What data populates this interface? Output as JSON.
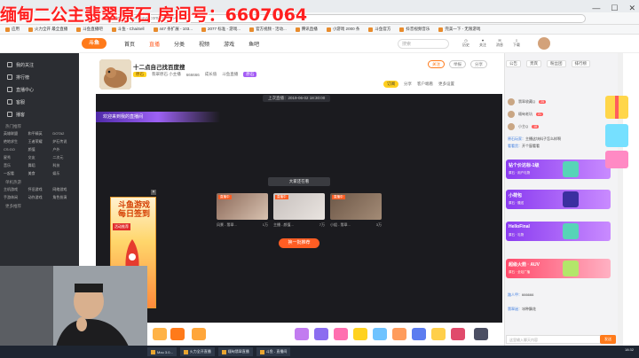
{
  "overlay_title": "缅甸二公主翡翠原石 房间号：6607064",
  "window": {
    "min": "—",
    "max": "☐",
    "close": "✕"
  },
  "address_bar": {
    "url": "https://www.douyu.com/6607064"
  },
  "bookmarks": [
    "应用",
    "火力全开 最全直播",
    "斗鱼直播吧",
    "斗鱼 - ChaiSell",
    "447 条扩展 - 103...",
    "2077 标准 - 游戏...",
    "官方视频 - 活动...",
    "腾讯直播",
    "小游戏 2000 条",
    "斗鱼官方",
    "抖音视频音乐",
    "完美一下 - 无限游戏"
  ],
  "nav": {
    "logo": "斗鱼",
    "items": [
      "首页",
      "直播",
      "分类",
      "视频",
      "游戏",
      "鱼吧"
    ],
    "active_index": 1,
    "search_placeholder": "搜索",
    "icons": [
      {
        "name": "history-icon",
        "label": "历史"
      },
      {
        "name": "follow-icon",
        "label": "关注"
      },
      {
        "name": "message-icon",
        "label": "消息"
      },
      {
        "name": "download-icon",
        "label": "下载"
      }
    ]
  },
  "sidebar": {
    "items": [
      "我的关注",
      "排行榜",
      "直播中心",
      "客服",
      "播客"
    ],
    "section_hot": "热门推荐",
    "hot_grid": [
      "英雄联盟",
      "和平精英",
      "DOTA2",
      "绝地求生",
      "王者荣耀",
      "炉石传说",
      "CS:GO",
      "颜值",
      "户外",
      "星秀",
      "交友",
      "二次元",
      "音乐",
      "舞蹈",
      "科技",
      "一起看",
      "美食",
      "娱乐"
    ],
    "section_games": "单机热游",
    "games_grid": [
      "主机游戏",
      "怀旧游戏",
      "网络游戏",
      "手游休闲",
      "动作游戏",
      "角色扮演"
    ],
    "section_more": "更多推荐"
  },
  "room": {
    "title": "十二点自己找百度搜",
    "tag": "原石",
    "category": "翡翠原石 小主播",
    "meta": [
      "666666",
      "成长值",
      "斗鱼直播"
    ],
    "tag2": "原石",
    "buttons": [
      "关注",
      "举报",
      "分享"
    ],
    "actions": [
      "订阅",
      "分享",
      "客户端看",
      "更多设置"
    ]
  },
  "player": {
    "time_label": "上次直播：2019-06-02 18:30:00",
    "welcome": "欢迎来到我的直播间",
    "rec_label": "大家还在看",
    "thumbs": [
      {
        "badge": "直播中",
        "caption": "风景 - 翡翠...",
        "viewers": "1万",
        "color": "#8c6a5a"
      },
      {
        "badge": "直播中",
        "caption": "主播 - 颜值...",
        "viewers": "7万",
        "color": "#c7c0bd"
      },
      {
        "badge": "直播中",
        "caption": "小姐 - 翡翠...",
        "viewers": "3万",
        "color": "#6e5848"
      }
    ],
    "refresh": "换一批推荐"
  },
  "ad": {
    "title": "斗鱼游戏 每日签到",
    "badge": "活动推荐",
    "close": "×"
  },
  "chat": {
    "tabs": [
      "公告",
      "贵宾",
      "粉丝团",
      "排行榜"
    ],
    "ranks": [
      {
        "name": "翡翠收藏Q",
        "level": "25"
      },
      {
        "name": "缅甸老坑",
        "level": "21"
      },
      {
        "name": "小主Q",
        "level": "18"
      }
    ],
    "messages": [
      {
        "user": "原石玩家：",
        "text": "主播这块料子怎么样啊"
      },
      {
        "user": "看看货：",
        "text": "开个窗看看"
      },
      {
        "user": "路人甲：",
        "text": "666666"
      },
      {
        "user": "翡翠迷：",
        "text": "冰种飘花"
      }
    ],
    "gift_cards": [
      {
        "title": "钻个价达标-1级",
        "sub": "原石 · 用户礼物"
      },
      {
        "title": "小荷包",
        "sub": "原石 · 赠送"
      },
      {
        "title": "HelloFinal",
        "sub": "原石 · 礼物"
      },
      {
        "title": "超级火箭 · AUV",
        "sub": "原石 · 全站广播"
      }
    ],
    "input_placeholder": "这里输入聊天内容",
    "send": "发送"
  },
  "taskbar": {
    "items": [
      "Mou 3.0...",
      "火力全开直播",
      "缅甸翡翠直播",
      "斗鱼 - 直播间"
    ],
    "time": "18:32"
  }
}
